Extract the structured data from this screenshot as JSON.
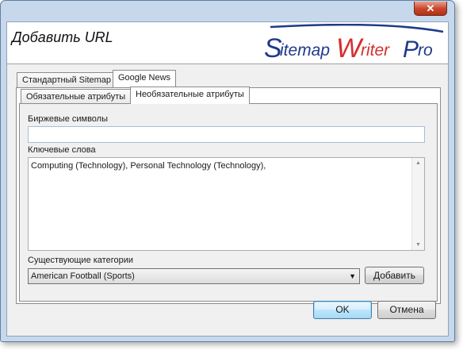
{
  "window": {
    "close_glyph": "✕"
  },
  "header": {
    "title": "Добавить URL",
    "logo_text": "SitemapWriterPro",
    "logo_color": "#1e3a8a",
    "logo_accent": "#d62e2e"
  },
  "tabs_outer": [
    {
      "label": "Стандартный Sitemap"
    },
    {
      "label": "Google News"
    }
  ],
  "tabs_inner": [
    {
      "label": "Обязательные атрибуты"
    },
    {
      "label": "Необязательные атрибуты"
    }
  ],
  "form": {
    "stock_label": "Биржевые символы",
    "stock_value": "",
    "keywords_label": "Ключевые слова",
    "keywords_value": "Computing (Technology), Personal Technology (Technology),",
    "categories_label": "Существующие категории",
    "categories_selected": "American Football (Sports)",
    "add_label": "Добавить"
  },
  "footer": {
    "ok_label": "OK",
    "cancel_label": "Отмена"
  }
}
